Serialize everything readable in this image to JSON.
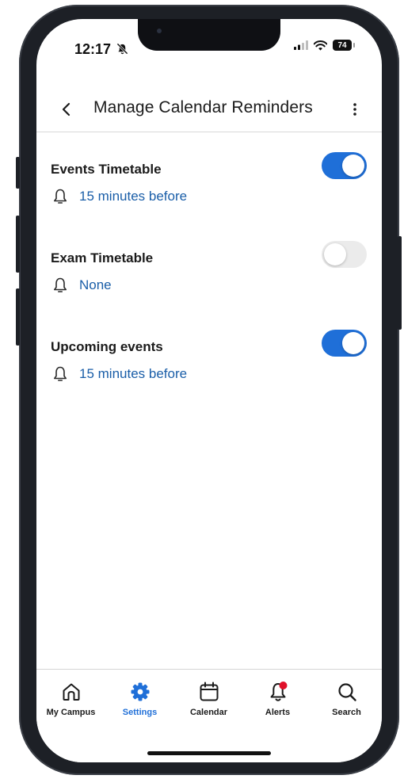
{
  "status_bar": {
    "time": "12:17",
    "battery": "74"
  },
  "header": {
    "title": "Manage Calendar Reminders"
  },
  "settings": [
    {
      "title": "Events Timetable",
      "enabled": true,
      "reminder": "15 minutes before"
    },
    {
      "title": "Exam Timetable",
      "enabled": false,
      "reminder": "None"
    },
    {
      "title": "Upcoming events",
      "enabled": true,
      "reminder": "15 minutes before"
    }
  ],
  "tabs": [
    {
      "label": "My Campus",
      "icon": "home-icon",
      "active": false
    },
    {
      "label": "Settings",
      "icon": "gear-icon",
      "active": true
    },
    {
      "label": "Calendar",
      "icon": "calendar-icon",
      "active": false
    },
    {
      "label": "Alerts",
      "icon": "bell-icon",
      "active": false,
      "badge": true
    },
    {
      "label": "Search",
      "icon": "search-icon",
      "active": false
    }
  ],
  "colors": {
    "accent": "#1f6fd8",
    "link": "#1a5ea8",
    "badge": "#e0102a",
    "toggle_off": "#ebebeb"
  }
}
